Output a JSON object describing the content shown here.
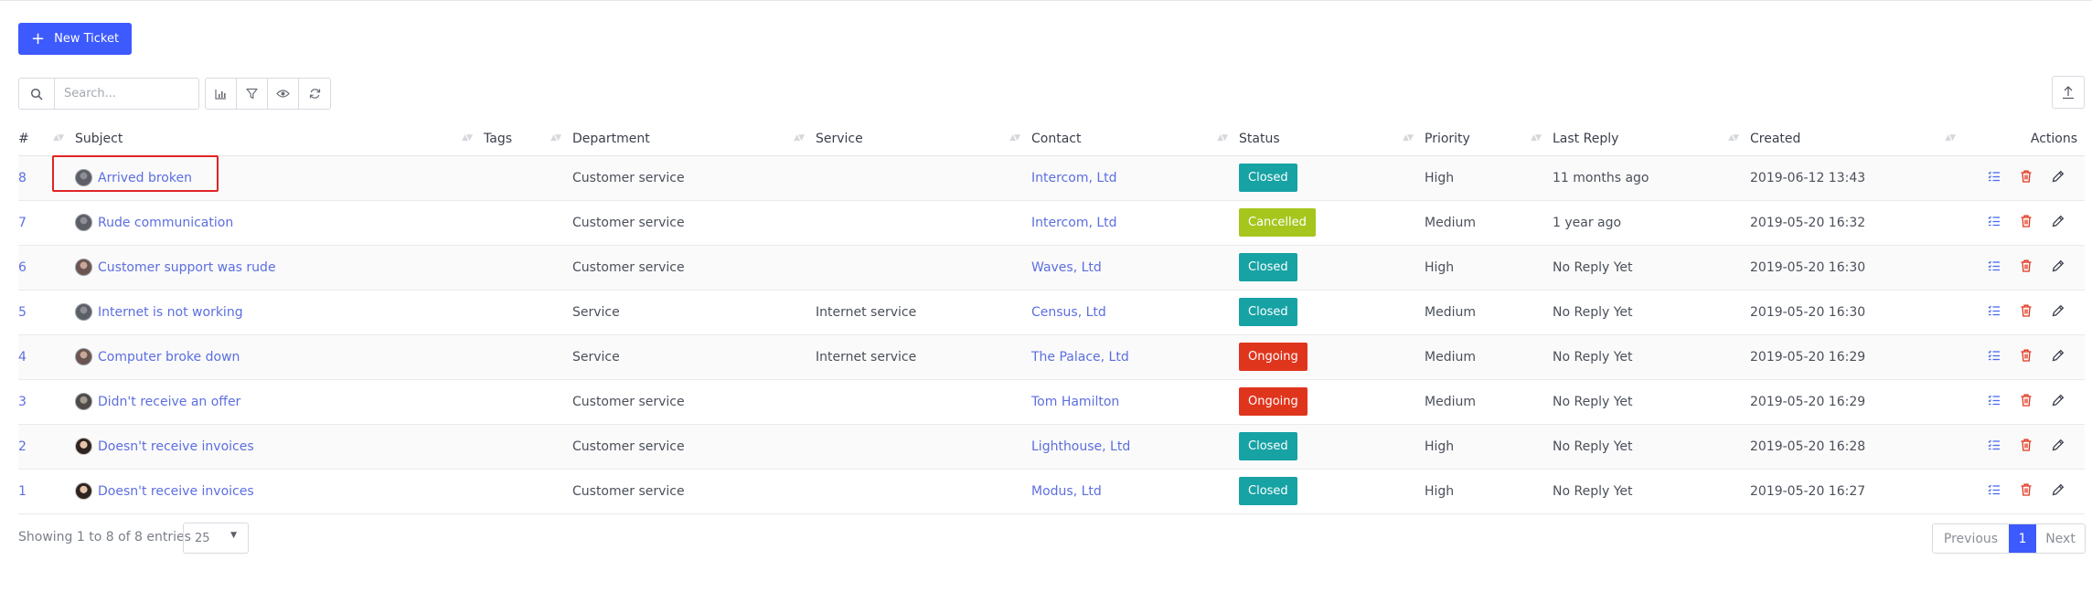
{
  "toolbar": {
    "new_ticket_label": "New Ticket",
    "search_placeholder": "Search..."
  },
  "table": {
    "headers": [
      "#",
      "Subject",
      "Tags",
      "Department",
      "Service",
      "Contact",
      "Status",
      "Priority",
      "Last Reply",
      "Created",
      "Actions"
    ],
    "rows": [
      {
        "id": "8",
        "subject": "Arrived broken",
        "tags": "",
        "department": "Customer service",
        "service": "",
        "contact": "Intercom, Ltd",
        "status": "Closed",
        "priority": "High",
        "last_reply": "11 months ago",
        "created": "2019-06-12 13:43",
        "avatar": "a1"
      },
      {
        "id": "7",
        "subject": "Rude communication",
        "tags": "",
        "department": "Customer service",
        "service": "",
        "contact": "Intercom, Ltd",
        "status": "Cancelled",
        "priority": "Medium",
        "last_reply": "1 year ago",
        "created": "2019-05-20 16:32",
        "avatar": "a1"
      },
      {
        "id": "6",
        "subject": "Customer support was rude",
        "tags": "",
        "department": "Customer service",
        "service": "",
        "contact": "Waves, Ltd",
        "status": "Closed",
        "priority": "High",
        "last_reply": "No Reply Yet",
        "created": "2019-05-20 16:30",
        "avatar": "a2"
      },
      {
        "id": "5",
        "subject": "Internet is not working",
        "tags": "",
        "department": "Service",
        "service": "Internet service",
        "contact": "Census, Ltd",
        "status": "Closed",
        "priority": "Medium",
        "last_reply": "No Reply Yet",
        "created": "2019-05-20 16:30",
        "avatar": "a1"
      },
      {
        "id": "4",
        "subject": "Computer broke down",
        "tags": "",
        "department": "Service",
        "service": "Internet service",
        "contact": "The Palace, Ltd",
        "status": "Ongoing",
        "priority": "Medium",
        "last_reply": "No Reply Yet",
        "created": "2019-05-20 16:29",
        "avatar": "a2"
      },
      {
        "id": "3",
        "subject": "Didn't receive an offer",
        "tags": "",
        "department": "Customer service",
        "service": "",
        "contact": "Tom Hamilton",
        "status": "Ongoing",
        "priority": "Medium",
        "last_reply": "No Reply Yet",
        "created": "2019-05-20 16:29",
        "avatar": "a3"
      },
      {
        "id": "2",
        "subject": "Doesn't receive invoices",
        "tags": "",
        "department": "Customer service",
        "service": "",
        "contact": "Lighthouse, Ltd",
        "status": "Closed",
        "priority": "High",
        "last_reply": "No Reply Yet",
        "created": "2019-05-20 16:28",
        "avatar": "a4"
      },
      {
        "id": "1",
        "subject": "Doesn't receive invoices",
        "tags": "",
        "department": "Customer service",
        "service": "",
        "contact": "Modus, Ltd",
        "status": "Closed",
        "priority": "High",
        "last_reply": "No Reply Yet",
        "created": "2019-05-20 16:27",
        "avatar": "a4"
      }
    ]
  },
  "status_colors": {
    "Closed": "#17a2a4",
    "Cancelled": "#a6c61e",
    "Ongoing": "#e0351d"
  },
  "action_icons": [
    "tasks-icon",
    "trash-icon",
    "pencil-icon"
  ],
  "footer": {
    "info": "Showing 1 to 8 of 8 entries",
    "page_size": "25",
    "prev_label": "Previous",
    "current_page": "1",
    "next_label": "Next"
  }
}
